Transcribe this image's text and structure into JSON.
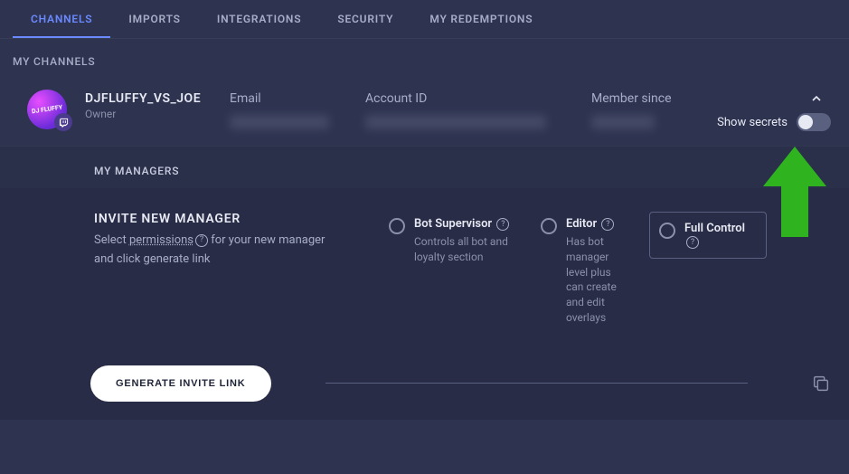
{
  "tabs": {
    "channels": "CHANNELS",
    "imports": "IMPORTS",
    "integrations": "INTEGRATIONS",
    "security": "SECURITY",
    "redemptions": "MY REDEMPTIONS"
  },
  "sections": {
    "my_channels": "MY CHANNELS",
    "my_managers": "MY MANAGERS"
  },
  "user": {
    "name": "DJFLUFFY_VS_JOE",
    "role": "Owner",
    "avatar_text": "DJ FLUFFY"
  },
  "fields": {
    "email": "Email",
    "account_id": "Account ID",
    "member_since": "Member since"
  },
  "show_secrets_label": "Show secrets",
  "invite": {
    "title": "INVITE NEW MANAGER",
    "desc_pre": "Select ",
    "permissions_word": "permissions",
    "desc_post_1": "  for your new manager",
    "desc_post_2": "and click generate link"
  },
  "permissions": {
    "bot": {
      "name": "Bot Supervisor",
      "desc": "Controls all bot and loyalty section"
    },
    "editor": {
      "name": "Editor",
      "desc": "Has bot manager level plus can create and edit overlays"
    },
    "full": {
      "name": "Full Control",
      "desc": ""
    }
  },
  "generate_button": "GENERATE INVITE LINK",
  "colors": {
    "accent": "#6b89ff",
    "annotation_arrow": "#2fb41f"
  }
}
